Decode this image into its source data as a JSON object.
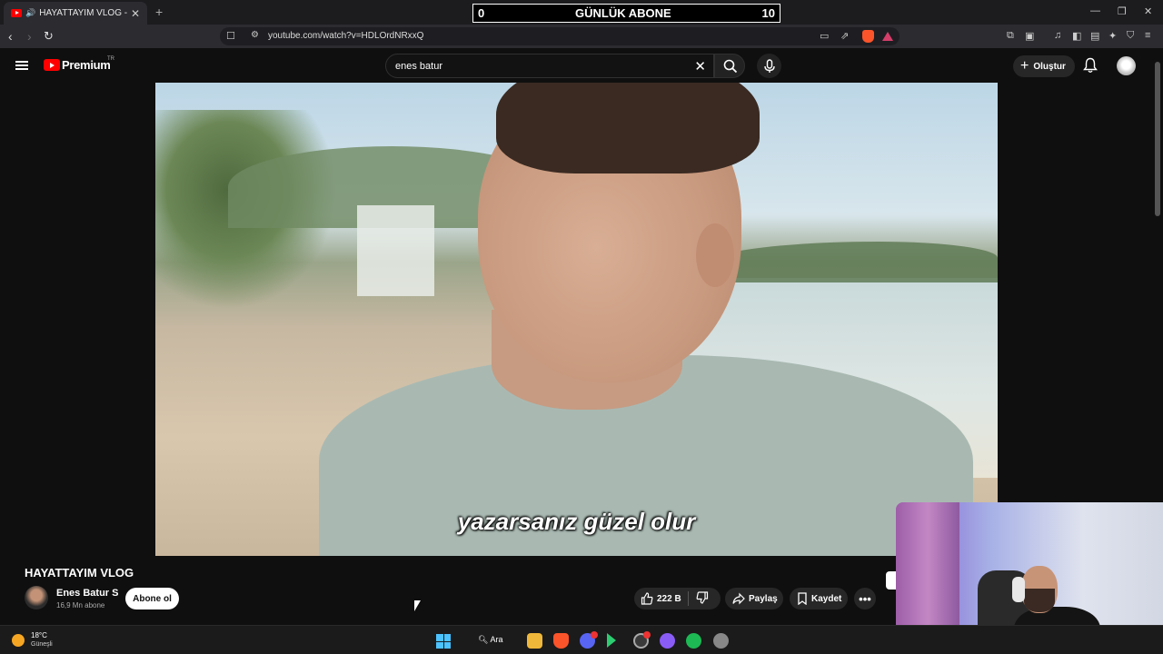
{
  "browser": {
    "tab_title": "HAYATTAYIM VLOG - YouTube",
    "url": "youtube.com/watch?v=HDLOrdNRxxQ"
  },
  "overlay": {
    "left_value": "0",
    "label": "GÜNLÜK ABONE",
    "right_value": "10"
  },
  "youtube": {
    "logo_text": "Premium",
    "region": "TR",
    "search_query": "enes batur",
    "create_label": "Oluştur"
  },
  "video": {
    "subtitle": "yazarsanız güzel olur",
    "title": "HAYATTAYIM VLOG",
    "channel_name": "Enes Batur S",
    "subscriber_count": "16,9 Mn abone",
    "subscribe_label": "Abone ol",
    "like_count": "222 B",
    "share_label": "Paylaş",
    "save_label": "Kaydet"
  },
  "taskbar": {
    "temperature": "18°C",
    "condition": "Güneşli",
    "search_label": "Ara"
  },
  "colors": {
    "youtube_red": "#ff0000",
    "bg": "#0f0f0f",
    "win_accent": "#4cc2ff"
  }
}
